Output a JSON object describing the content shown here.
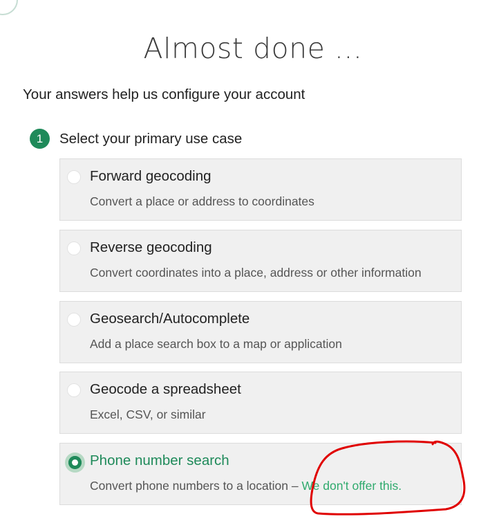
{
  "header": {
    "title": "Almost done ...",
    "subtitle": "Your answers help us configure your account"
  },
  "step": {
    "number": "1",
    "label": "Select your primary use case"
  },
  "options": [
    {
      "title": "Forward geocoding",
      "description": "Convert a place or address to coordinates",
      "selected": false
    },
    {
      "title": "Reverse geocoding",
      "description": "Convert coordinates into a place, address or other information",
      "selected": false
    },
    {
      "title": "Geosearch/Autocomplete",
      "description": "Add a place search box to a map or application",
      "selected": false
    },
    {
      "title": "Geocode a spreadsheet",
      "description": "Excel, CSV, or similar",
      "selected": false
    },
    {
      "title": "Phone number search",
      "description": "Convert phone numbers to a location –",
      "annotation": "We don't offer this.",
      "selected": true
    }
  ],
  "colors": {
    "accent": "#1f8a5a",
    "annotation_text": "#2faa6d",
    "annotation_circle": "#e00000",
    "option_background": "#f0f0f0"
  }
}
